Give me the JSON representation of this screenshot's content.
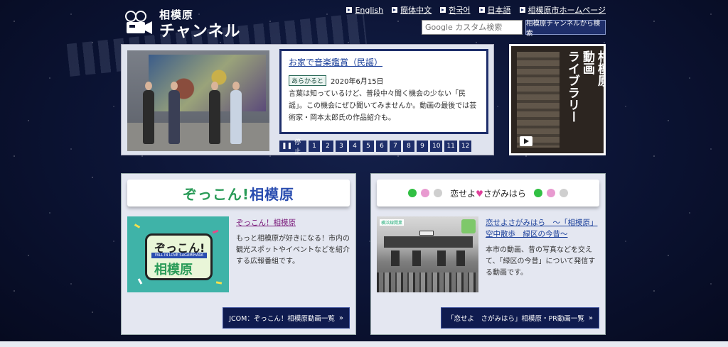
{
  "site": {
    "logo_small": "相模原",
    "logo_big": "チャンネル"
  },
  "languages": [
    {
      "label": "English"
    },
    {
      "label": "簡体中文"
    },
    {
      "label": "한국어"
    },
    {
      "label": "日本語"
    },
    {
      "label": "相模原市ホームページ"
    }
  ],
  "search": {
    "placeholder": "Google カスタム検索",
    "button_label": "相模原チャンネルから検索"
  },
  "hero": {
    "title": "お家で音楽鑑賞（民謡）",
    "tag": "あらかると",
    "date": "2020年6月15日",
    "description": "言葉は知っているけど、普段中々聞く機会の少ない「民謡」。この機会にぜひ聞いてみませんか。動画の最後では芸術家・岡本太郎氏の作品紹介も。",
    "stop_label": "停止",
    "pages": [
      "1",
      "2",
      "3",
      "4",
      "5",
      "6",
      "7",
      "8",
      "9",
      "10",
      "11",
      "12"
    ]
  },
  "library": {
    "line1": "相模原",
    "line2": "動画",
    "line3": "ライブラリー"
  },
  "panel_left": {
    "banner_part1": "ぞっこん!",
    "banner_part2": "相模原",
    "thumb_line1": "ぞっこん!",
    "thumb_band": "FALL IN LOVE SAGAMIHARA",
    "thumb_line2": "相模原",
    "title": "ぞっこん！相模原",
    "description": "もっと相模原が好きになる！市内の観光スポットやイベントなどを紹介する広報番組です。",
    "button_label": "JCOM：ぞっこん！相模原動画一覧"
  },
  "panel_right": {
    "banner_text1": "恋せよ",
    "banner_text2": "さがみはら",
    "thumb_label": "横浜線開業",
    "title": "恋せよさがみはら　～「相模原」空中散歩　緑区の今昔～",
    "description": "本市の動画、昔の写真などを交えて、「緑区の今昔」について発信する動画です。",
    "button_label": "「恋せよ　さがみはら」相模原・PR動画一覧"
  },
  "colors": {
    "background": "#0b1333",
    "accent_navy": "#1e2e6a",
    "link_blue": "#1a3f9a",
    "zokkon_green": "#2a9b58",
    "dot_green": "#31c043",
    "dot_pink": "#e89ad0",
    "dot_gray": "#cfcfcf"
  }
}
